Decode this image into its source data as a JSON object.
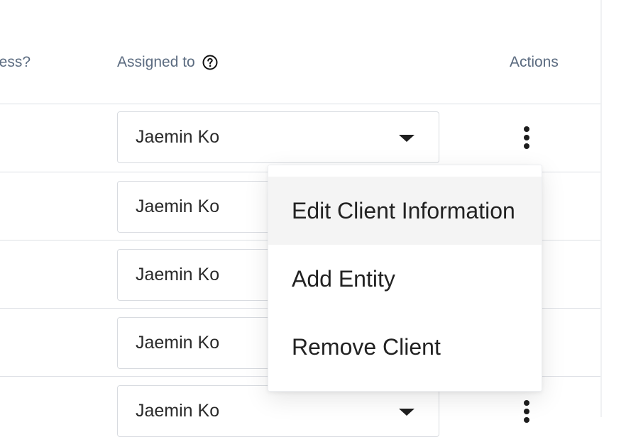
{
  "table": {
    "headers": {
      "cut_off": "less?",
      "assigned_to": "Assigned to",
      "actions": "Actions"
    },
    "rows": [
      {
        "assigned_to": "Jaemin Ko"
      },
      {
        "assigned_to": "Jaemin Ko"
      },
      {
        "assigned_to": "Jaemin Ko"
      },
      {
        "assigned_to": "Jaemin Ko"
      },
      {
        "assigned_to": "Jaemin Ko"
      }
    ]
  },
  "actions_menu": {
    "items": [
      {
        "label": "Edit Client Information",
        "highlighted": true
      },
      {
        "label": "Add Entity",
        "highlighted": false
      },
      {
        "label": "Remove Client",
        "highlighted": false
      }
    ]
  },
  "icons": {
    "help": "question-circle-icon",
    "dropdown": "caret-down-icon",
    "row_actions": "more-vertical-icon"
  },
  "colors": {
    "header_text": "#5b6b80",
    "border": "#d8dbe0",
    "menu_hover": "#f4f4f4"
  }
}
